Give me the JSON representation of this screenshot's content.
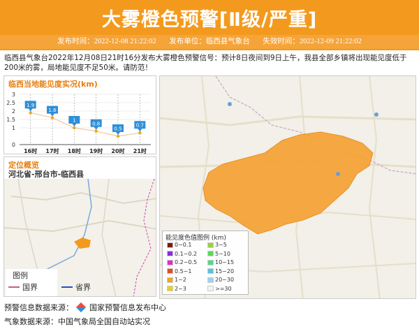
{
  "header": {
    "title": "大雾橙色预警[Ⅱ级/严重]",
    "publish_label": "发布时间：2022-12-08 21:22:02",
    "issuer_label": "发布单位：临西县气象台",
    "expire_label": "失效时间：2022-12-09 21:22:02"
  },
  "description": "临西县气象台2022年12月08日21时16分发布大雾橙色预警信号：预计8日夜间到9日上午，我县全部乡镇将出现能见度低于200米的雾，局地能见度不足50米。请防范！",
  "visibility_panel": {
    "title": "临西当地能见度实况(km)"
  },
  "location_panel": {
    "title": "定位概览",
    "region": "河北省-邢台市-临西县",
    "legend_title": "图例",
    "legend_country": "国界",
    "legend_province": "省界"
  },
  "map_legend": {
    "title": "能见度色值图例 (km)",
    "items": [
      {
        "label": "0~0.1",
        "color": "#7b1c0e"
      },
      {
        "label": "3~5",
        "color": "#9ad13c"
      },
      {
        "label": "0.1~0.2",
        "color": "#8a2be2"
      },
      {
        "label": "5~10",
        "color": "#59d85a"
      },
      {
        "label": "0.2~0.5",
        "color": "#e02ec5"
      },
      {
        "label": "10~15",
        "color": "#52d98d"
      },
      {
        "label": "0.5~1",
        "color": "#e64a1e"
      },
      {
        "label": "15~20",
        "color": "#57c3d9"
      },
      {
        "label": "1~2",
        "color": "#f2a51c"
      },
      {
        "label": "20~30",
        "color": "#9bd3ec"
      },
      {
        "label": "2~3",
        "color": "#e6d21e"
      },
      {
        "label": ">=30",
        "color": "#f2f2f2"
      }
    ]
  },
  "footer": {
    "line1": "预警信息数据来源：",
    "source1": "国家预警信息发布中心",
    "line2": "气象数据来源：中国气象局全国自动站实况"
  },
  "colors": {
    "banner": "#f39a1e",
    "accent": "#e67e10",
    "pin": "#2f8fd8",
    "line": "#f0a91e"
  },
  "chart_data": {
    "type": "line",
    "title": "临西当地能见度实况(km)",
    "categories": [
      "16时",
      "17时",
      "18时",
      "19时",
      "20时",
      "21时"
    ],
    "values": [
      1.9,
      1.6,
      1,
      0.8,
      0.5,
      0.7
    ],
    "value_labels": [
      "1.9",
      "1.6",
      "1",
      "0.8",
      "0.5",
      "0.7"
    ],
    "ylim": [
      0,
      3
    ],
    "yticks": [
      "0",
      "1",
      "1.5",
      "2",
      "2.5",
      "3"
    ],
    "grid": true
  }
}
